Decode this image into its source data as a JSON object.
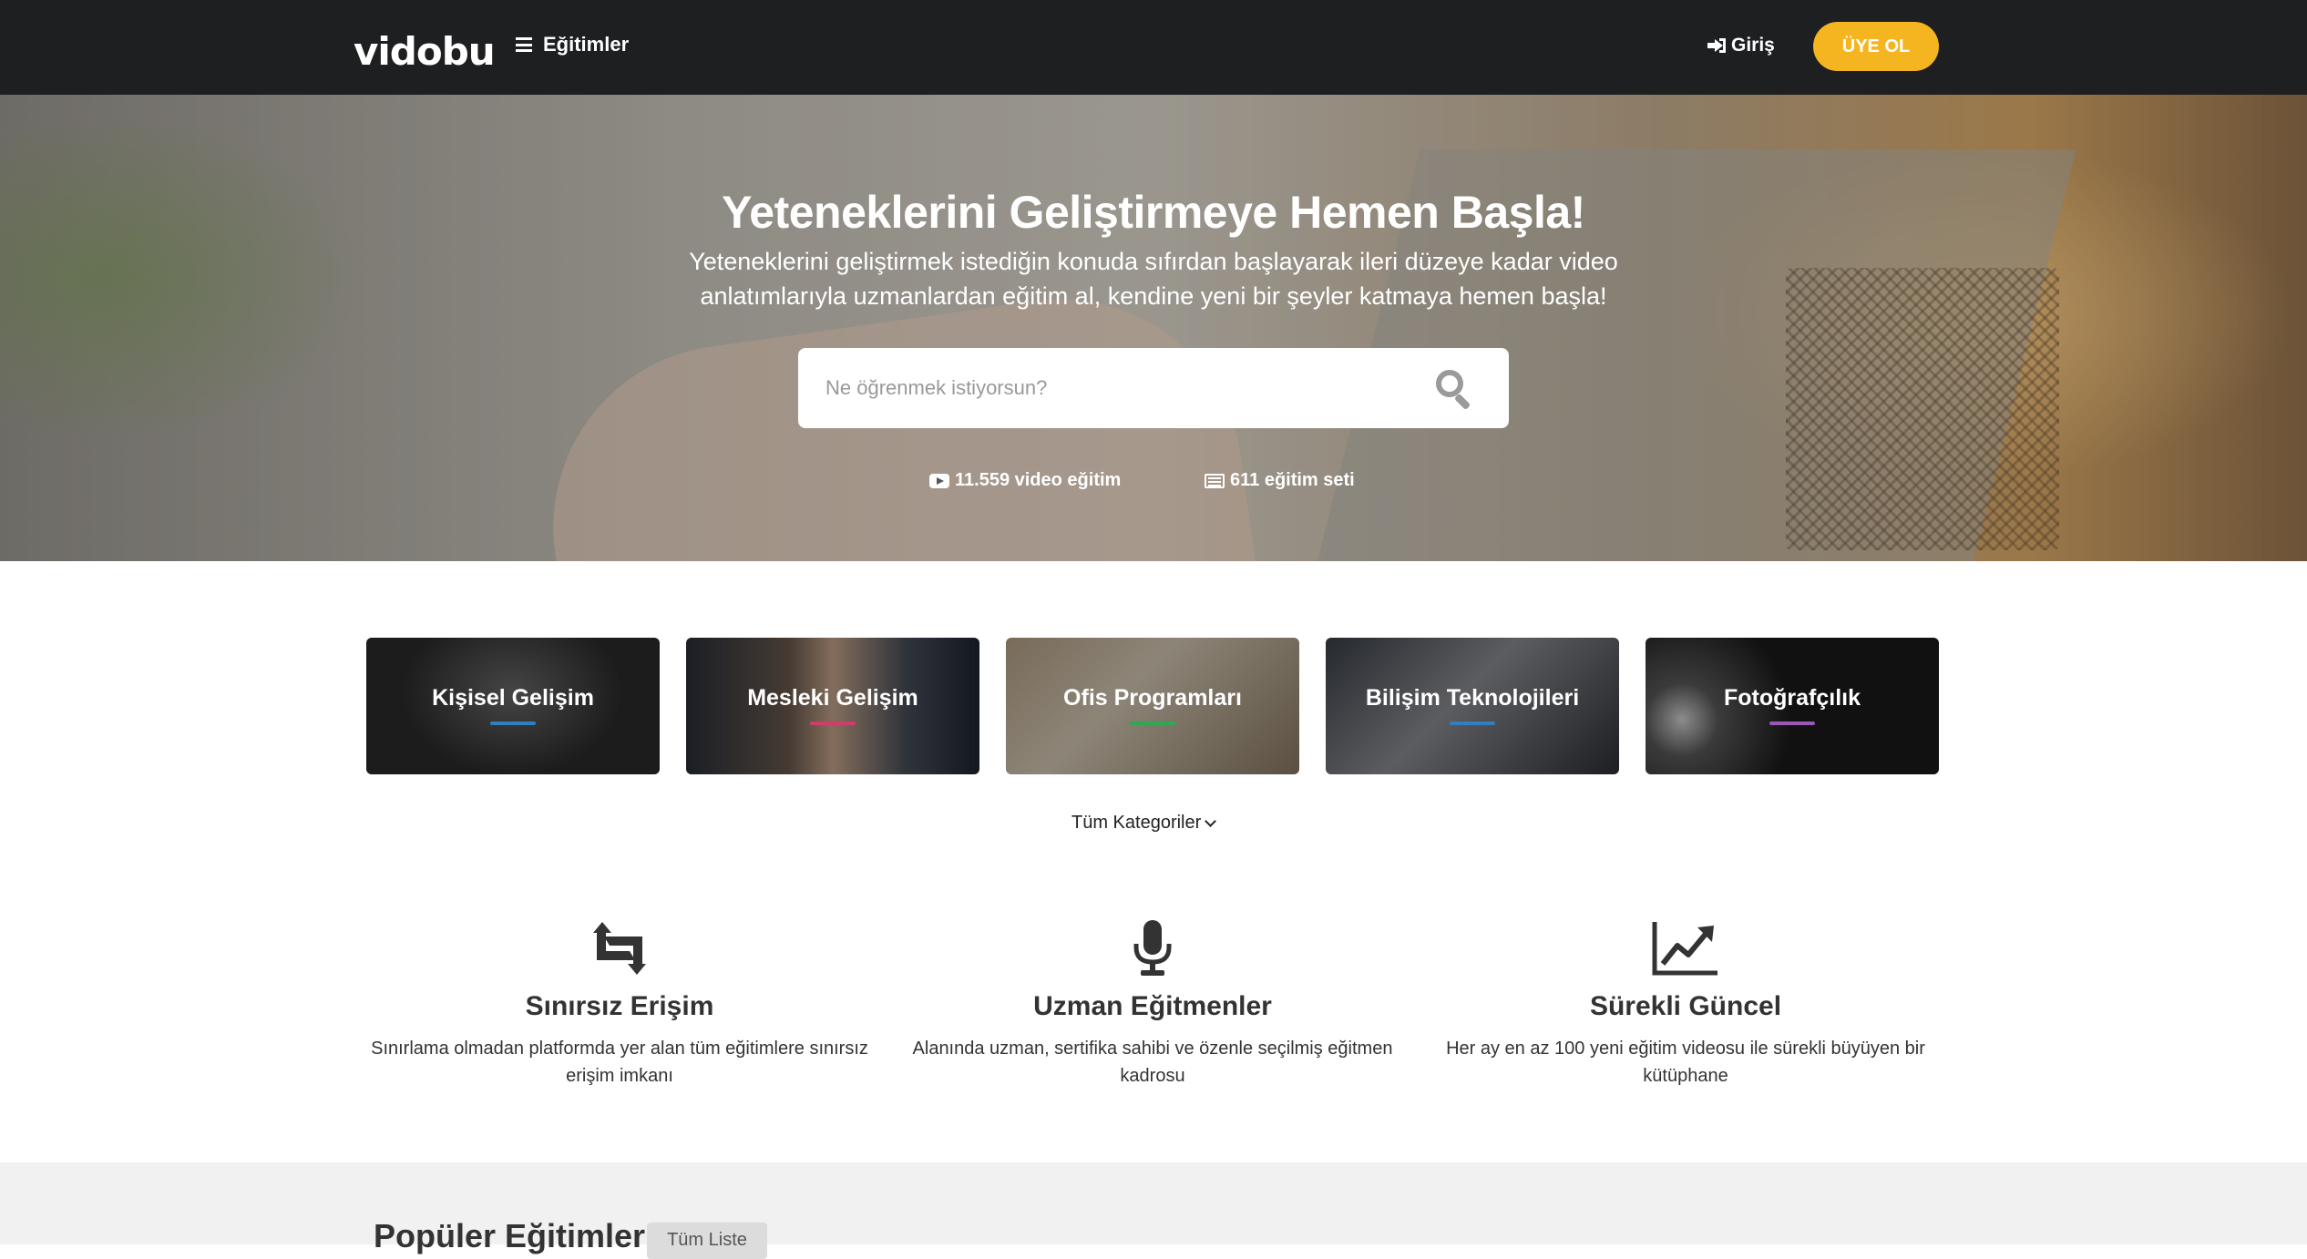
{
  "nav": {
    "logo_text": "vidobu",
    "menu_label": "Eğitimler",
    "login_label": "Giriş",
    "signup_label": "ÜYE OL"
  },
  "hero": {
    "title": "Yeteneklerini Geliştirmeye Hemen Başla!",
    "subtitle": "Yeteneklerini geliştirmek istediğin konuda sıfırdan başlayarak ileri düzeye kadar video anlatımlarıyla uzmanlardan eğitim al, kendine yeni bir şeyler katmaya hemen başla!",
    "search_placeholder": "Ne öğrenmek istiyorsun?",
    "stats": [
      {
        "icon": "youtube-icon",
        "label": "11.559 video eğitim"
      },
      {
        "icon": "list-icon",
        "label": "611 eğitim seti"
      }
    ]
  },
  "categories": [
    {
      "label": "Kişisel Gelişim",
      "accent": "#2f7fc1"
    },
    {
      "label": "Mesleki Gelişim",
      "accent": "#d23b6a"
    },
    {
      "label": "Ofis Programları",
      "accent": "#2fa84f"
    },
    {
      "label": "Bilişim Teknolojileri",
      "accent": "#2f7fc1"
    },
    {
      "label": "Fotoğrafçılık",
      "accent": "#9b59b6"
    }
  ],
  "all_categories_label": "Tüm Kategoriler",
  "features": [
    {
      "icon": "retweet-icon",
      "title": "Sınırsız Erişim",
      "text": "Sınırlama olmadan platformda yer alan tüm eğitimlere sınırsız erişim imkanı"
    },
    {
      "icon": "microphone-icon",
      "title": "Uzman Eğitmenler",
      "text": "Alanında uzman, sertifika sahibi ve özenle seçilmiş eğitmen kadrosu"
    },
    {
      "icon": "line-chart-icon",
      "title": "Sürekli Güncel",
      "text": "Her ay en az 100 yeni eğitim videosu ile sürekli büyüyen bir kütüphane"
    }
  ],
  "popular": {
    "title": "Popüler Eğitimler",
    "button_label": "Tüm Liste"
  },
  "colors": {
    "topbar": "#1e1f21",
    "accent": "#f4b521"
  }
}
